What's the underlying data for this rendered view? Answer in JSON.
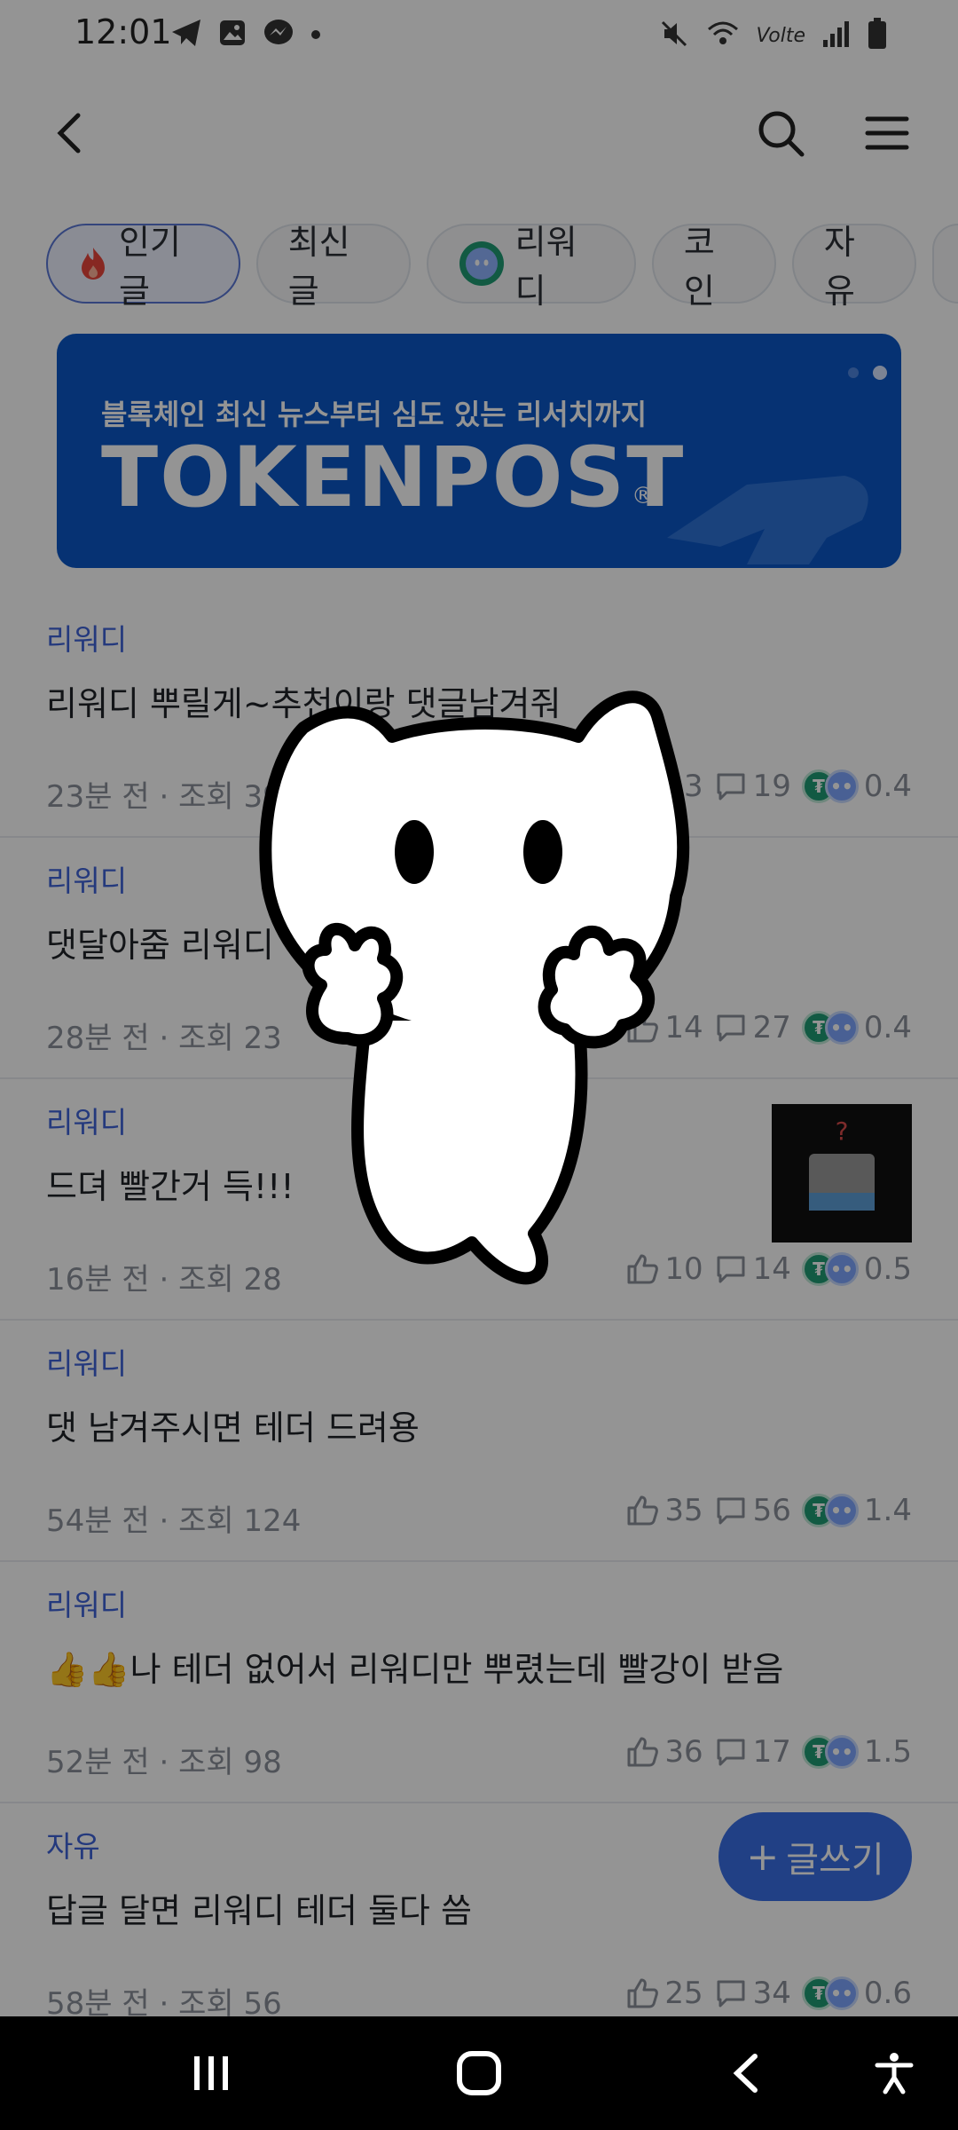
{
  "status_bar": {
    "time": "12:01",
    "left_icons": [
      "telegram-icon",
      "gallery-icon",
      "messenger-icon",
      "dot-icon"
    ],
    "right_icons": [
      "mute-icon",
      "wifi-icon",
      "volte-icon",
      "signal-icon",
      "battery-icon"
    ],
    "volte_label": "Volte"
  },
  "top_bar": {
    "back_icon": "chevron-left-icon",
    "search_icon": "search-icon",
    "menu_icon": "hamburger-icon"
  },
  "tabs": [
    {
      "label": "인기글",
      "icon": "fire-icon",
      "active": true
    },
    {
      "label": "최신글"
    },
    {
      "label": "리워디",
      "icon": "rewardy-icon"
    },
    {
      "label": "코인"
    },
    {
      "label": "자유"
    }
  ],
  "banner": {
    "subtitle": "블록체인 최신 뉴스부터 심도 있는 리서치까지",
    "brand": "TOKENPOST",
    "reg": "®"
  },
  "posts": [
    {
      "category": "리워디",
      "title": "리워디 뿌릴게~추천이랑 댓글남겨줘",
      "time": "23분 전",
      "views": "조회 39",
      "likes": "13",
      "comments": "19",
      "reward": "0.4"
    },
    {
      "category": "리워디",
      "title": "댓달아줌 리워디",
      "time": "28분 전",
      "views": "조회 23",
      "likes": "14",
      "comments": "27",
      "reward": "0.4"
    },
    {
      "category": "리워디",
      "title": "드뎌 빨간거 득!!!",
      "time": "16분 전",
      "views": "조회 28",
      "likes": "10",
      "comments": "14",
      "reward": "0.5",
      "has_thumbnail": true
    },
    {
      "category": "리워디",
      "title": "댓 남겨주시면 테더 드려용",
      "time": "54분 전",
      "views": "조회 124",
      "likes": "35",
      "comments": "56",
      "reward": "1.4"
    },
    {
      "category": "리워디",
      "title": "👍👍나 테더 없어서 리워디만 뿌렸는데 빨강이 받음",
      "time": "52분 전",
      "views": "조회 98",
      "likes": "36",
      "comments": "17",
      "reward": "1.5"
    },
    {
      "category": "자유",
      "title": "답글 달면 리워디 테더 둘다 씀",
      "time": "58분 전",
      "views": "조회 56",
      "likes": "25",
      "comments": "34",
      "reward": "0.6"
    }
  ],
  "meta_separator": " · ",
  "fab": {
    "label": "글쓰기",
    "icon": "plus-icon"
  },
  "nav_bar": {
    "icons": [
      "recent-apps-icon",
      "home-icon",
      "back-icon",
      "accessibility-icon"
    ]
  },
  "colors": {
    "accent": "#3a6fe6",
    "category": "#3e63d8",
    "banner": "#0b57c7",
    "tether": "#1f9c74"
  }
}
